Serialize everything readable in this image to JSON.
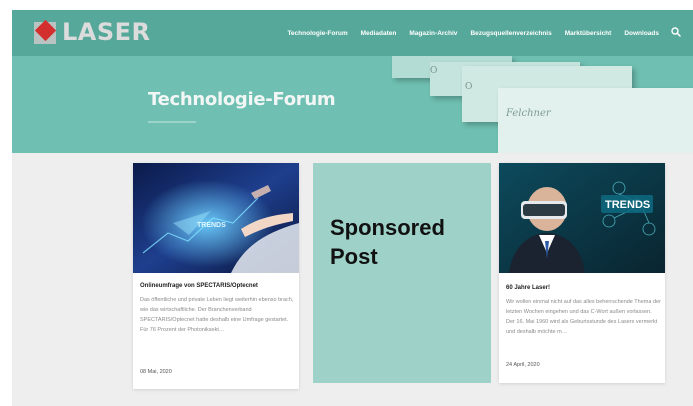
{
  "header": {
    "logo_text": "LASER",
    "nav": [
      "Technologie-Forum",
      "Mediadaten",
      "Magazin-Archiv",
      "Bezugsquellenverzeichnis",
      "Marktübersicht",
      "Downloads"
    ]
  },
  "hero": {
    "title": "Technologie-Forum",
    "image_brand": "Felchner"
  },
  "cards": [
    {
      "image_label": "TRENDS",
      "title": "Onlineumfrage von SPECTARIS/Optecnet",
      "excerpt": "Das öffentliche und private Leben liegt weiterhin ebenso brach, wie das wirtschaftliche. Der Branchenverband SPECTARIS/Optecnet hatte deshalb eine Umfrage gestartet. Für 76 Prozent der Photoniksekt…",
      "date": "08 Mai, 2020"
    },
    {
      "image_label": "TRENDS",
      "title": "60 Jahre Laser!",
      "excerpt": "Wir wollen einmal nicht auf das alles beherrschende Thema der letzten Wochen eingehen und das C-Wort außen vorlassen. Der 16. Mai 1960 wird als Geburtsstunde des Lasers vermerkt und deshalb möchte m…",
      "date": "24 April, 2020"
    }
  ],
  "sponsored": {
    "label": "Sponsored Post"
  },
  "colors": {
    "header_bg": "#56a89a",
    "hero_bg": "#6fc0b2",
    "sponsored_bg": "#9ed2c8",
    "content_bg": "#eeeeee",
    "logo_accent": "#d32f2f"
  },
  "icons": {
    "search": "search-icon"
  }
}
